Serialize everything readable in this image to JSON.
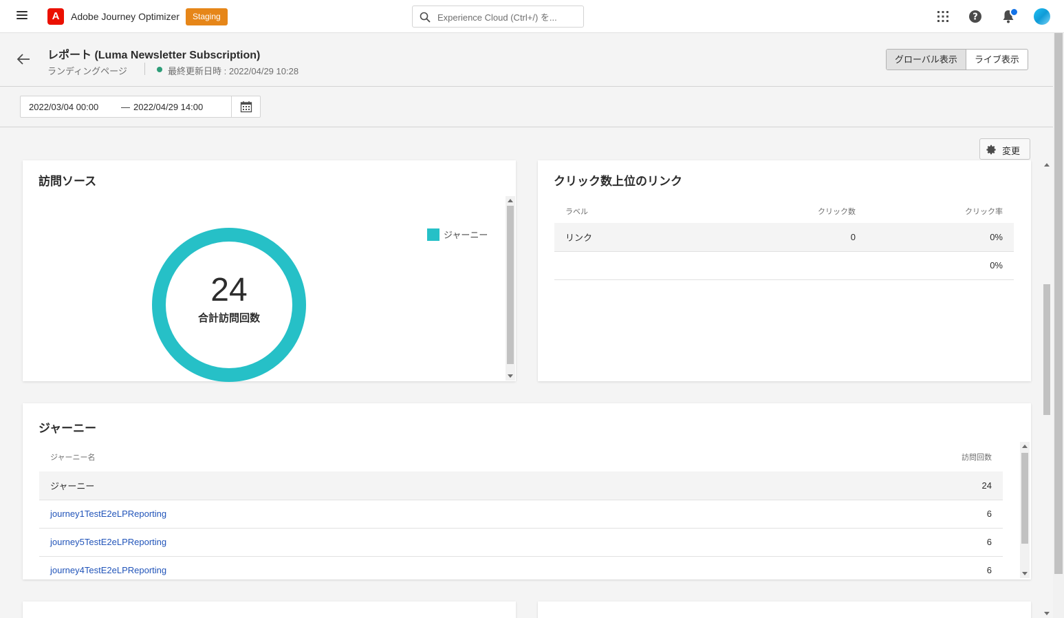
{
  "topnav": {
    "app_title": "Adobe Journey Optimizer",
    "logo_letter": "A",
    "env_badge": "Staging",
    "search_placeholder": "Experience Cloud (Ctrl+/) を...",
    "icons": [
      "menu-icon",
      "adobe-logo",
      "search-icon",
      "apps-grid-icon",
      "help-icon",
      "bell-icon",
      "avatar"
    ]
  },
  "header": {
    "title": "レポート (Luma Newsletter Subscription)",
    "subtitle": "ランディングページ",
    "last_updated": "最終更新日時 : 2022/04/29 10:28",
    "views": [
      {
        "label": "グローバル表示",
        "active": true
      },
      {
        "label": "ライブ表示",
        "active": false
      }
    ]
  },
  "daterange": {
    "start": "2022/03/04 00:00",
    "separator": "—",
    "end": "2022/04/29 14:00"
  },
  "change_button": "変更",
  "visits_card": {
    "title": "訪問ソース",
    "total": "24",
    "total_label": "合計訪問回数",
    "legend": [
      {
        "label": "ジャーニー",
        "color": "#26c0c7"
      }
    ],
    "segments": [
      {
        "label": "ジャーニー",
        "value": 24
      }
    ]
  },
  "links_card": {
    "title": "クリック数上位のリンク",
    "columns": [
      "ラベル",
      "クリック数",
      "クリック率"
    ],
    "rows": [
      {
        "label": "リンク",
        "clicks": "0",
        "rate": "0%"
      },
      {
        "label": "",
        "clicks": "",
        "rate": "0%"
      }
    ]
  },
  "journeys_card": {
    "title": "ジャーニー",
    "columns": [
      "ジャーニー名",
      "訪問回数"
    ],
    "rows": [
      {
        "name": "ジャーニー",
        "visits": "24"
      },
      {
        "name": "journey1TestE2eLPReporting",
        "visits": "6"
      },
      {
        "name": "journey5TestE2eLPReporting",
        "visits": "6"
      },
      {
        "name": "journey4TestE2eLPReporting",
        "visits": "6"
      }
    ]
  }
}
